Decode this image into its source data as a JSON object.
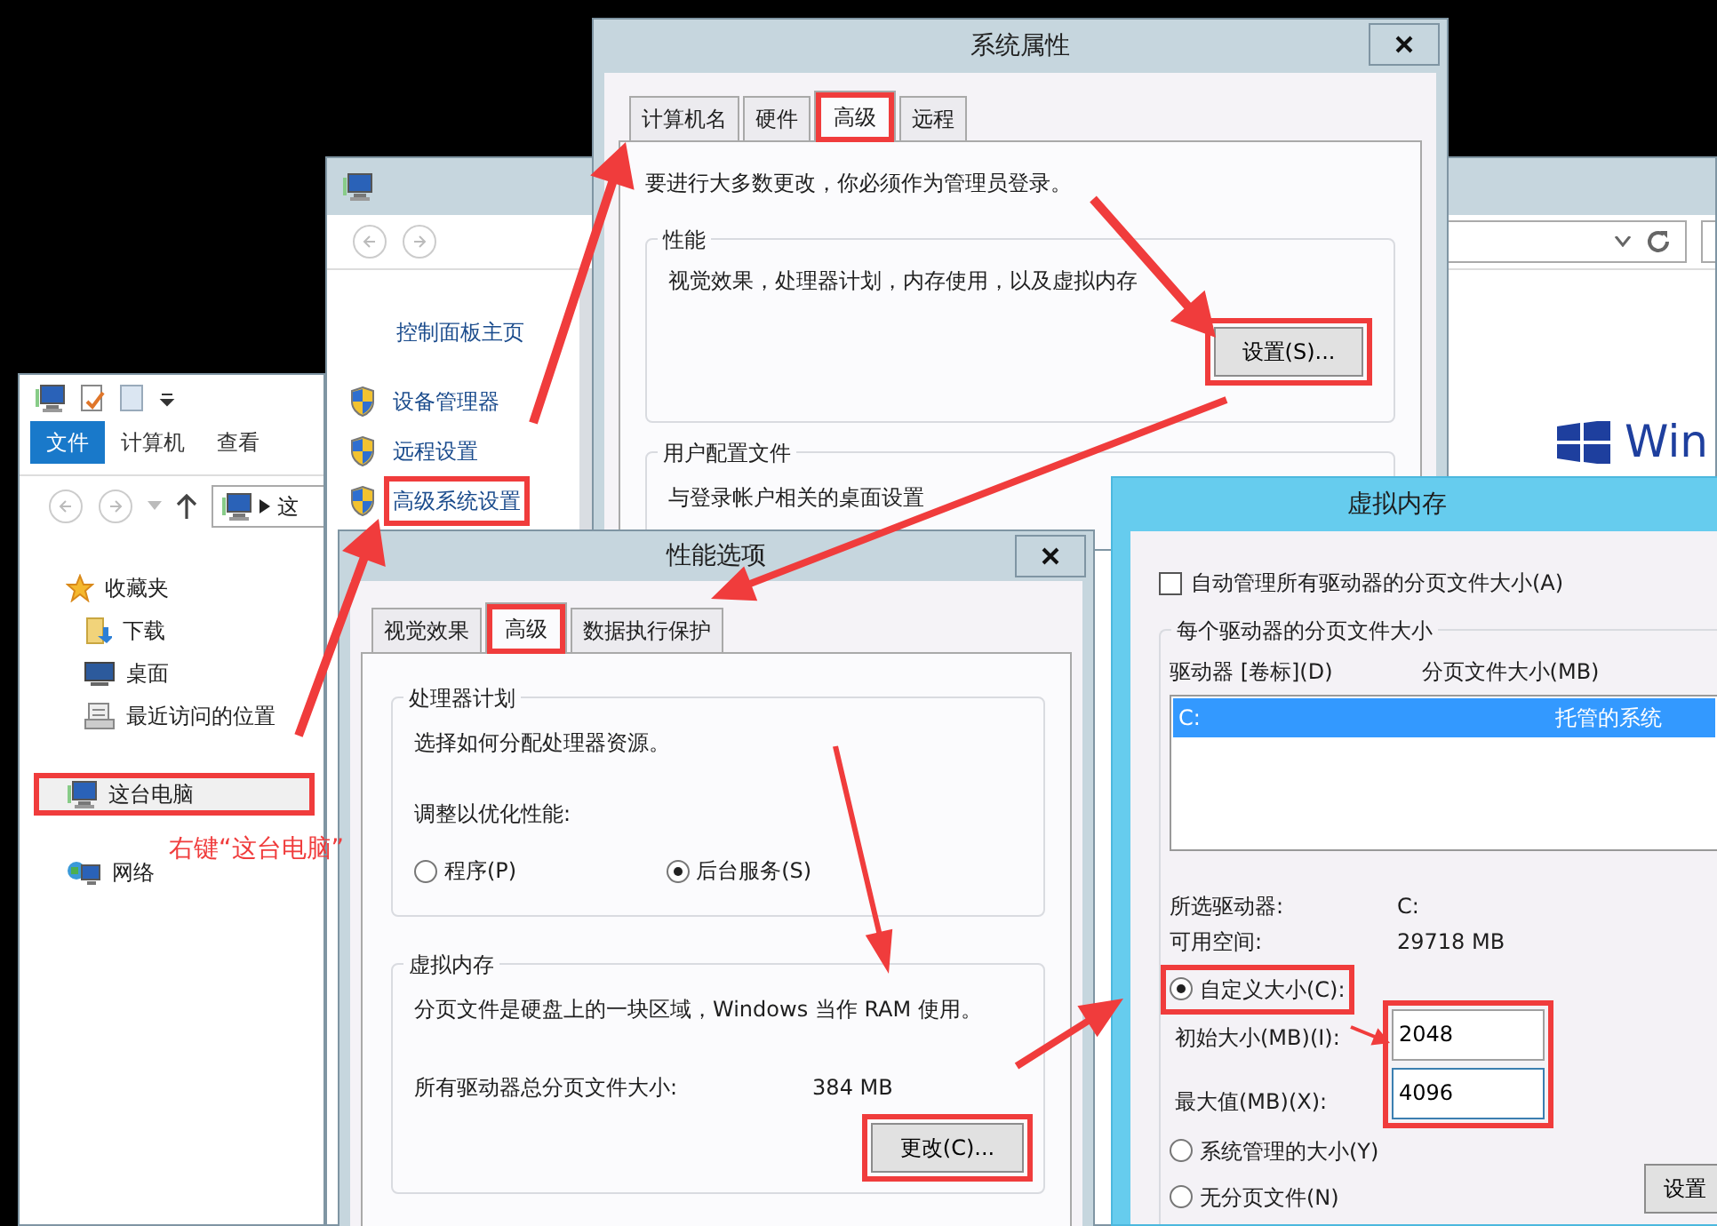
{
  "explorer": {
    "ribbon_tabs": [
      {
        "label": "文件",
        "selected": true
      },
      {
        "label": "计算机",
        "selected": false
      },
      {
        "label": "查看",
        "selected": false
      }
    ],
    "address": "这",
    "nav_items": [
      {
        "label": "收藏夹",
        "kind": "favorites",
        "selected": false,
        "highlighted": false,
        "children": [
          {
            "label": "下载",
            "kind": "downloads",
            "selected": false,
            "highlighted": false
          },
          {
            "label": "桌面",
            "kind": "desktop",
            "selected": false,
            "highlighted": false
          },
          {
            "label": "最近访问的位置",
            "kind": "recent",
            "selected": false,
            "highlighted": false
          }
        ]
      },
      {
        "label": "这台电脑",
        "kind": "computer",
        "selected": true,
        "highlighted": true
      },
      {
        "label": "网络",
        "kind": "network",
        "selected": false,
        "highlighted": false
      }
    ]
  },
  "annotation_note": "右键“这台电脑”",
  "control_panel": {
    "home_link": "控制面板主页",
    "tasks": [
      {
        "label": "设备管理器"
      },
      {
        "label": "远程设置"
      },
      {
        "label": "高级系统设置",
        "highlighted": true
      }
    ],
    "logo_text": "Win"
  },
  "system_properties": {
    "title": "系统属性",
    "tabs": [
      {
        "label": "计算机名",
        "selected": false,
        "highlighted": false
      },
      {
        "label": "硬件",
        "selected": false,
        "highlighted": false
      },
      {
        "label": "高级",
        "selected": true,
        "highlighted": true
      },
      {
        "label": "远程",
        "selected": false,
        "highlighted": false
      }
    ],
    "admin_note": "要进行大多数更改，你必须作为管理员登录。",
    "performance": {
      "title": "性能",
      "description": "视觉效果，处理器计划，内存使用，以及虚拟内存",
      "button": {
        "label": "设置(S)...",
        "highlighted": true
      }
    },
    "user_profiles": {
      "title": "用户配置文件",
      "description": "与登录帐户相关的桌面设置"
    }
  },
  "performance_options": {
    "title": "性能选项",
    "tabs": [
      {
        "label": "视觉效果",
        "selected": false,
        "highlighted": false
      },
      {
        "label": "高级",
        "selected": true,
        "highlighted": true
      },
      {
        "label": "数据执行保护",
        "selected": false,
        "highlighted": false
      }
    ],
    "processor_scheduling": {
      "title": "处理器计划",
      "description": "选择如何分配处理器资源。",
      "prompt": "调整以优化性能:",
      "options": [
        {
          "label": "程序(P)",
          "selected": false
        },
        {
          "label": "后台服务(S)",
          "selected": true
        }
      ]
    },
    "virtual_memory": {
      "title": "虚拟内存",
      "description": "分页文件是硬盘上的一块区域，Windows 当作 RAM 使用。",
      "total_label": "所有驱动器总分页文件大小:",
      "total_value": "384 MB",
      "button": {
        "label": "更改(C)...",
        "highlighted": true
      }
    }
  },
  "virtual_memory": {
    "title": "虚拟内存",
    "auto_manage": {
      "label": "自动管理所有驱动器的分页文件大小(A)",
      "checked": false
    },
    "group_title": "每个驱动器的分页文件大小",
    "columns": [
      "驱动器 [卷标](D)",
      "分页文件大小(MB)"
    ],
    "drives": [
      {
        "drive": "C:",
        "paging_size": "托管的系统",
        "selected": true
      }
    ],
    "selected_drive_label": "所选驱动器:",
    "selected_drive_value": "C:",
    "free_space_label": "可用空间:",
    "free_space_value": "29718 MB",
    "size_options": [
      {
        "label": "自定义大小(C):",
        "selected": true,
        "highlighted": true
      },
      {
        "label": "系统管理的大小(Y)",
        "selected": false
      },
      {
        "label": "无分页文件(N)",
        "selected": false
      }
    ],
    "initial_label": "初始大小(MB)(I):",
    "initial_value": "2048",
    "max_label": "最大值(MB)(X):",
    "max_value": "4096",
    "fields_highlighted": true,
    "set_button": "设置"
  }
}
